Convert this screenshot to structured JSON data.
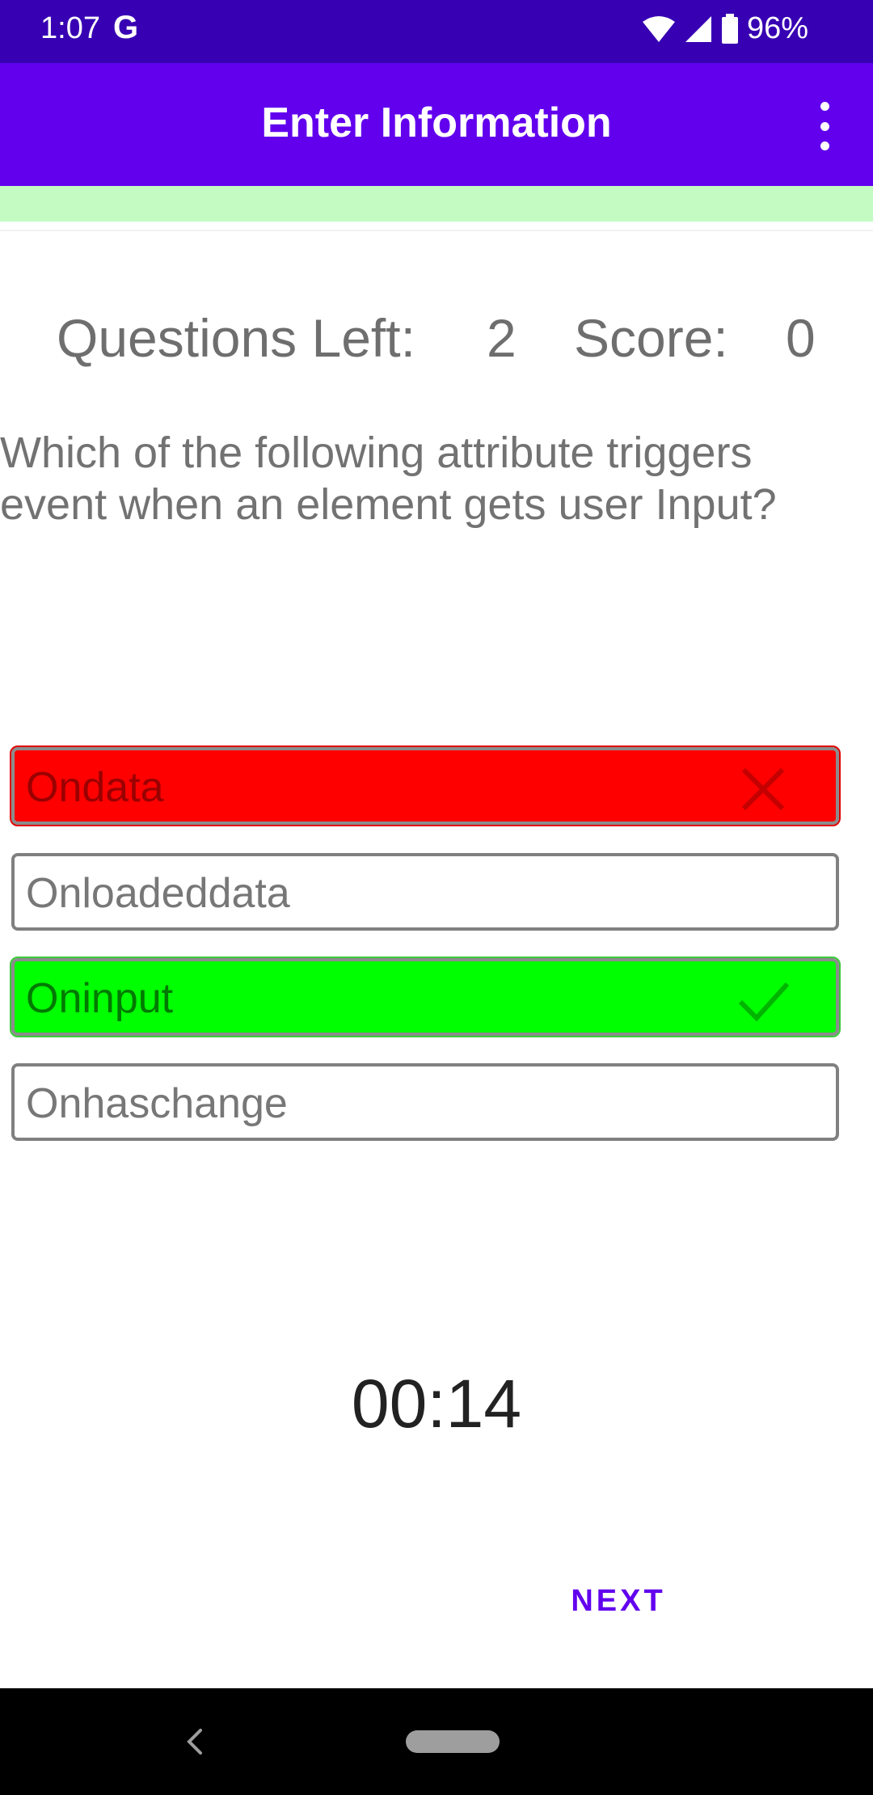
{
  "status_bar": {
    "time": "1:07",
    "google_icon": "G",
    "battery": "96%",
    "icons": [
      "wifi-icon",
      "signal-icon",
      "battery-icon"
    ]
  },
  "app_bar": {
    "title": "Enter Information",
    "menu_icon": "more-vert-icon"
  },
  "stats": {
    "questions_left_label": "Questions Left:",
    "questions_left_value": "2",
    "score_label": "Score:",
    "score_value": "0"
  },
  "question": {
    "text": "Which of the following attribute triggers event when an element gets user Input?"
  },
  "options": [
    {
      "label": "Ondata",
      "state": "wrong",
      "icon": "close-icon"
    },
    {
      "label": "Onloadeddata",
      "state": "normal"
    },
    {
      "label": "Oninput",
      "state": "correct",
      "icon": "check-icon"
    },
    {
      "label": "Onhaschange",
      "state": "normal"
    }
  ],
  "timer": {
    "value": "00:14"
  },
  "actions": {
    "next_label": "NEXT"
  },
  "colors": {
    "status_bar": "#3700b3",
    "app_bar": "#6200ee",
    "accent": "#6200ee",
    "wrong": "#ff0000",
    "correct": "#00ff00",
    "progress_strip": "#c3fbc3"
  }
}
